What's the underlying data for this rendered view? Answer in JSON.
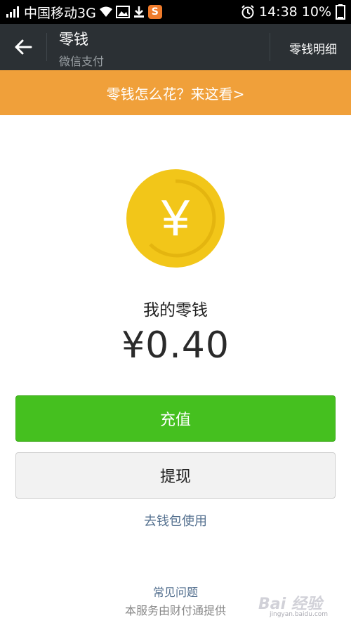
{
  "status_bar": {
    "carrier": "中国移动3G",
    "time": "14:38",
    "battery": "10%",
    "icons": [
      "signal-icon",
      "wifi-icon",
      "image-icon",
      "download-icon",
      "sogou-icon",
      "alarm-icon",
      "battery-icon"
    ],
    "sogou_glyph": "S"
  },
  "app_bar": {
    "title": "零钱",
    "subtitle": "微信支付",
    "detail_label": "零钱明细"
  },
  "banner": {
    "text": "零钱怎么花？来这看>"
  },
  "balance": {
    "currency_glyph": "¥",
    "label": "我的零钱",
    "amount": "¥0.40"
  },
  "actions": {
    "recharge_label": "充值",
    "withdraw_label": "提现",
    "wallet_link": "去钱包使用"
  },
  "footer": {
    "faq": "常见问题",
    "provider": "本服务由财付通提供"
  },
  "watermark": {
    "text": "Bai 经验",
    "url": "jingyan.baidu.com"
  },
  "colors": {
    "app_bar": "#2b3034",
    "banner": "#f0a03a",
    "primary_button": "#45c01f",
    "coin": "#f2c619",
    "link": "#54708f"
  }
}
